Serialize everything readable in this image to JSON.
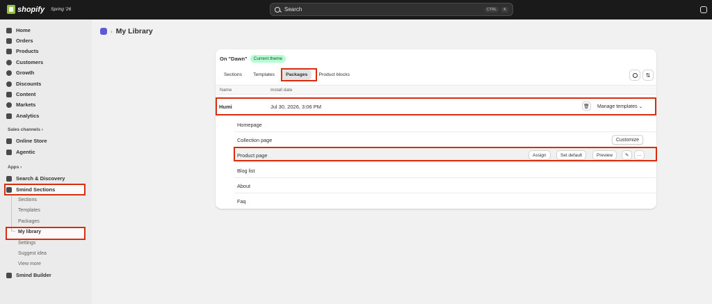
{
  "topbar": {
    "brand": "shopify",
    "edition": "Spring '26",
    "search_placeholder": "Search",
    "kbd1": "CTRL",
    "kbd2": "K"
  },
  "sidebar": {
    "items": [
      {
        "label": "Home",
        "icon": "home-icon"
      },
      {
        "label": "Orders",
        "icon": "orders-icon"
      },
      {
        "label": "Products",
        "icon": "tag-icon"
      },
      {
        "label": "Customers",
        "icon": "person-icon"
      },
      {
        "label": "Growth",
        "icon": "growth-icon"
      },
      {
        "label": "Discounts",
        "icon": "discount-icon"
      },
      {
        "label": "Content",
        "icon": "content-icon"
      },
      {
        "label": "Markets",
        "icon": "globe-icon"
      },
      {
        "label": "Analytics",
        "icon": "bar-chart-icon"
      }
    ],
    "sales_channels_label": "Sales channels",
    "channels": [
      {
        "label": "Online Store"
      },
      {
        "label": "Agentic"
      }
    ],
    "apps_label": "Apps",
    "apps": [
      {
        "label": "Search & Discovery"
      },
      {
        "label": "Smind Sections"
      }
    ],
    "smind_subitems": [
      "Sections",
      "Templates",
      "Packages",
      "My library",
      "Settings",
      "Suggest idea",
      "View more"
    ],
    "smind_builder": "Smind Builder"
  },
  "page": {
    "title": "My Library"
  },
  "card": {
    "theme_prefix": "On \"Dawn\"",
    "theme_badge": "Current theme",
    "tabs": [
      "Sections",
      "Templates",
      "Packages",
      "Product blocks"
    ],
    "columns": {
      "name": "Name",
      "install_date": "Install date"
    },
    "package": {
      "name": "Humi",
      "date": "Jul 30, 2026, 3:06 PM",
      "manage": "Manage templates"
    },
    "templates": [
      "Homepage",
      "Collection page",
      "Product page",
      "Blog list",
      "About",
      "Faq"
    ],
    "actions": {
      "assign": "Assign",
      "set_default": "Set default",
      "preview": "Preview",
      "customize": "Customize"
    }
  }
}
